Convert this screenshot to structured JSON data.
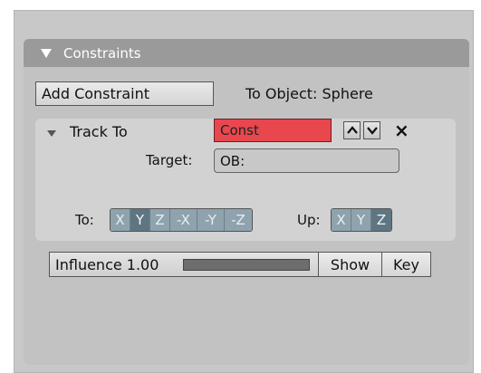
{
  "panel": {
    "title": "Constraints",
    "add_constraint_label": "Add Constraint",
    "to_object_text": "To Object: Sphere"
  },
  "constraint": {
    "name": "Track To",
    "const_field_value": "Const",
    "const_field_color": "#e8474e",
    "target_label": "Target:",
    "target_value": "OB:",
    "to_label": "To:",
    "to_axes": [
      {
        "label": "X",
        "active": false
      },
      {
        "label": "Y",
        "active": true
      },
      {
        "label": "Z",
        "active": false
      },
      {
        "label": "-X",
        "active": false
      },
      {
        "label": "-Y",
        "active": false
      },
      {
        "label": "-Z",
        "active": false
      }
    ],
    "up_label": "Up:",
    "up_axes": [
      {
        "label": "X",
        "active": false
      },
      {
        "label": "Y",
        "active": false
      },
      {
        "label": "Z",
        "active": true
      }
    ],
    "move_up_icon": "chevron-up-icon",
    "move_down_icon": "chevron-down-icon",
    "delete_icon": "close-icon",
    "delete_label": "×"
  },
  "influence": {
    "label": "Influence 1.00",
    "value": 1.0,
    "show_label": "Show",
    "key_label": "Key"
  }
}
